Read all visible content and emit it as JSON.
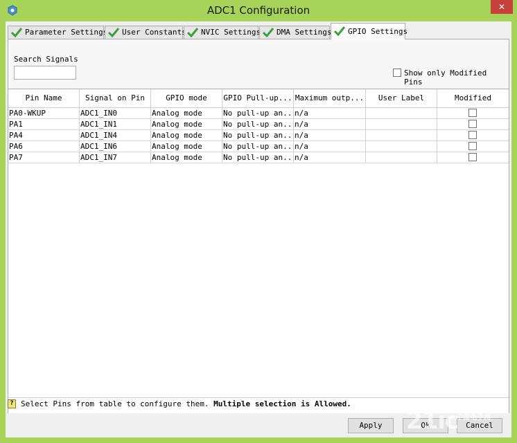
{
  "window": {
    "title": "ADC1 Configuration",
    "close_label": "✕"
  },
  "tabs": [
    {
      "label": "Parameter Settings",
      "active": false
    },
    {
      "label": "User Constants",
      "active": false
    },
    {
      "label": "NVIC Settings",
      "active": false
    },
    {
      "label": "DMA Settings",
      "active": false
    },
    {
      "label": "GPIO Settings",
      "active": true
    }
  ],
  "search": {
    "label": "Search Signals",
    "value": "",
    "placeholder": ""
  },
  "filter": {
    "show_modified_label": "Show only Modified Pins",
    "checked": false
  },
  "table": {
    "columns": [
      "Pin Name",
      "Signal on Pin",
      "GPIO mode",
      "GPIO Pull-up...",
      "Maximum outp...",
      "User Label",
      "Modified"
    ],
    "rows": [
      {
        "pin": "PA0-WKUP",
        "signal": "ADC1_IN0",
        "mode": "Analog mode",
        "pull": "No pull-up an...",
        "max": "n/a",
        "label": "",
        "modified": false
      },
      {
        "pin": "PA1",
        "signal": "ADC1_IN1",
        "mode": "Analog mode",
        "pull": "No pull-up an...",
        "max": "n/a",
        "label": "",
        "modified": false
      },
      {
        "pin": "PA4",
        "signal": "ADC1_IN4",
        "mode": "Analog mode",
        "pull": "No pull-up an...",
        "max": "n/a",
        "label": "",
        "modified": false
      },
      {
        "pin": "PA6",
        "signal": "ADC1_IN6",
        "mode": "Analog mode",
        "pull": "No pull-up an...",
        "max": "n/a",
        "label": "",
        "modified": false
      },
      {
        "pin": "PA7",
        "signal": "ADC1_IN7",
        "mode": "Analog mode",
        "pull": "No pull-up an...",
        "max": "n/a",
        "label": "",
        "modified": false
      }
    ]
  },
  "status": {
    "text": "Select Pins from table to configure them. ",
    "bold": "Multiple selection is Allowed."
  },
  "buttons": {
    "apply": "Apply",
    "ok": "Ok",
    "cancel": "Cancel"
  },
  "watermark": {
    "text": "21ic",
    "subtext": "中国电子网"
  },
  "colors": {
    "window_frame": "#a6d35a",
    "close": "#c7403a",
    "check_green": "#39a13a"
  }
}
